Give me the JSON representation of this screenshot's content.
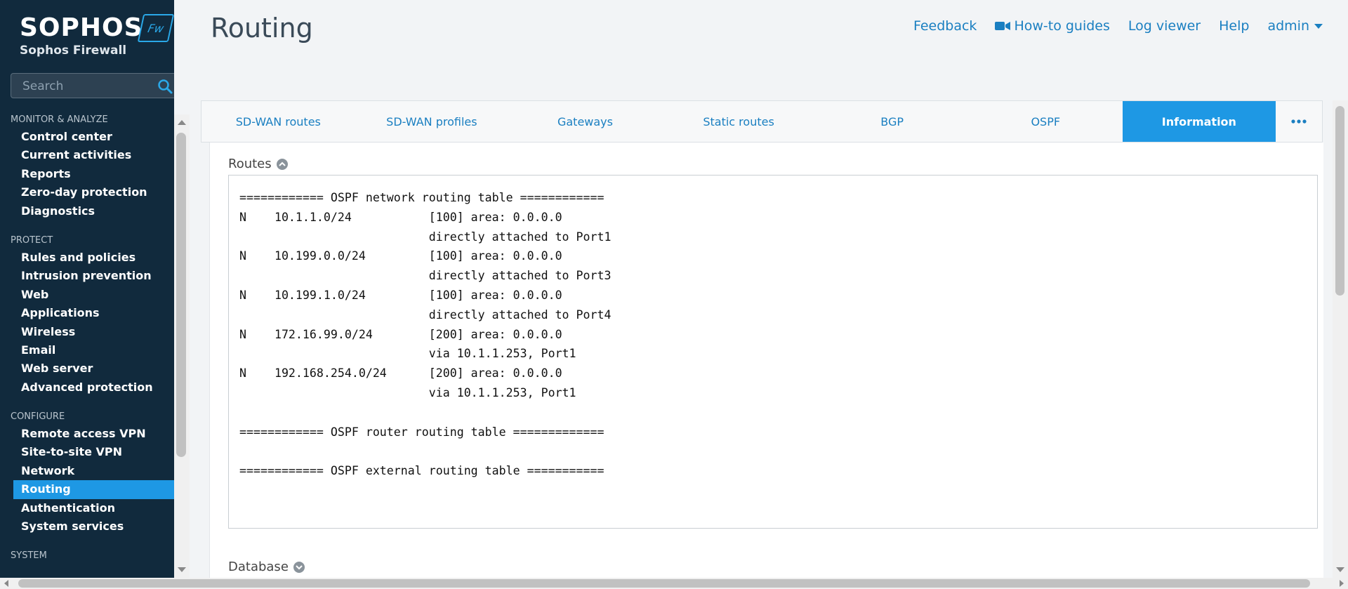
{
  "brand": {
    "name": "SOPHOS",
    "product": "Sophos Firewall",
    "badge": "Fw"
  },
  "search": {
    "placeholder": "Search"
  },
  "nav": {
    "sections": [
      {
        "title": "MONITOR & ANALYZE",
        "items": [
          "Control center",
          "Current activities",
          "Reports",
          "Zero-day protection",
          "Diagnostics"
        ]
      },
      {
        "title": "PROTECT",
        "items": [
          "Rules and policies",
          "Intrusion prevention",
          "Web",
          "Applications",
          "Wireless",
          "Email",
          "Web server",
          "Advanced protection"
        ]
      },
      {
        "title": "CONFIGURE",
        "items": [
          "Remote access VPN",
          "Site-to-site VPN",
          "Network",
          "Routing",
          "Authentication",
          "System services"
        ]
      },
      {
        "title": "SYSTEM",
        "items": []
      }
    ],
    "active": "Routing"
  },
  "header": {
    "title": "Routing",
    "links": {
      "feedback": "Feedback",
      "howto": "How-to guides",
      "log": "Log viewer",
      "help": "Help",
      "user": "admin"
    }
  },
  "tabs": {
    "items": [
      "SD-WAN routes",
      "SD-WAN profiles",
      "Gateways",
      "Static routes",
      "BGP",
      "OSPF",
      "Information"
    ],
    "active": "Information"
  },
  "routes": {
    "title": "Routes",
    "lines": [
      "============ OSPF network routing table ============",
      "N    10.1.1.0/24           [100] area: 0.0.0.0",
      "                           directly attached to Port1",
      "N    10.199.0.0/24         [100] area: 0.0.0.0",
      "                           directly attached to Port3",
      "N    10.199.1.0/24         [100] area: 0.0.0.0",
      "                           directly attached to Port4",
      "N    172.16.99.0/24        [200] area: 0.0.0.0",
      "                           via 10.1.1.253, Port1",
      "N    192.168.254.0/24      [200] area: 0.0.0.0",
      "                           via 10.1.1.253, Port1",
      "",
      "============ OSPF router routing table =============",
      "",
      "============ OSPF external routing table ==========="
    ]
  },
  "database": {
    "title": "Database"
  },
  "colors": {
    "sidebar": "#112a3d",
    "accent": "#1e98e4",
    "link": "#1a7fc1"
  }
}
